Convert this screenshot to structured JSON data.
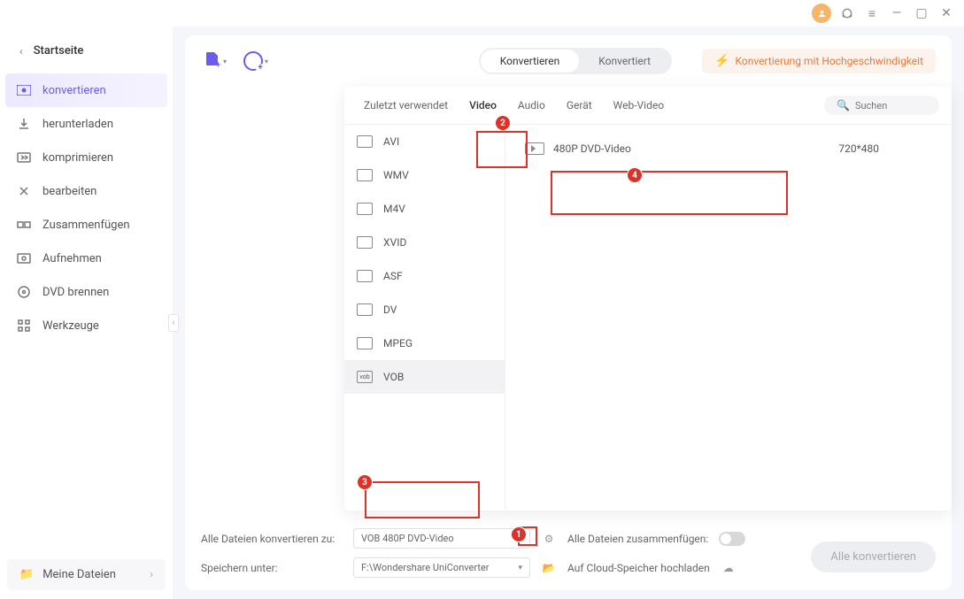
{
  "titlebar": {
    "minimize": "—",
    "maximize": "▢",
    "close": "✕"
  },
  "sidebar": {
    "home": "Startseite",
    "items": [
      {
        "label": "konvertieren",
        "icon": "convert"
      },
      {
        "label": "herunterladen",
        "icon": "download"
      },
      {
        "label": "komprimieren",
        "icon": "compress"
      },
      {
        "label": "bearbeiten",
        "icon": "edit"
      },
      {
        "label": "Zusammenfügen",
        "icon": "merge"
      },
      {
        "label": "Aufnehmen",
        "icon": "record"
      },
      {
        "label": "DVD brennen",
        "icon": "disc"
      },
      {
        "label": "Werkzeuge",
        "icon": "tools"
      }
    ],
    "my_files": "Meine Dateien"
  },
  "topbar": {
    "seg_convert": "Konvertieren",
    "seg_converted": "Konvertiert",
    "speed_label": "Konvertierung mit Hochgeschwindigkeit"
  },
  "panel": {
    "tabs": {
      "recent": "Zuletzt verwendet",
      "video": "Video",
      "audio": "Audio",
      "device": "Gerät",
      "web": "Web-Video"
    },
    "search_placeholder": "Suchen",
    "formats": [
      "AVI",
      "WMV",
      "M4V",
      "XVID",
      "ASF",
      "DV",
      "MPEG",
      "VOB"
    ],
    "preset": {
      "name": "480P DVD-Video",
      "res": "720*480"
    }
  },
  "bottom": {
    "convert_to_label": "Alle Dateien konvertieren zu:",
    "convert_to_value": "VOB 480P DVD-Video",
    "save_label": "Speichern unter:",
    "save_value": "F:\\Wondershare UniConverter",
    "merge_label": "Alle Dateien zusammenfügen:",
    "cloud_label": "Auf Cloud-Speicher hochladen",
    "convert_all_btn": "Alle konvertieren"
  },
  "annotations": {
    "a1": "1",
    "a2": "2",
    "a3": "3",
    "a4": "4"
  }
}
